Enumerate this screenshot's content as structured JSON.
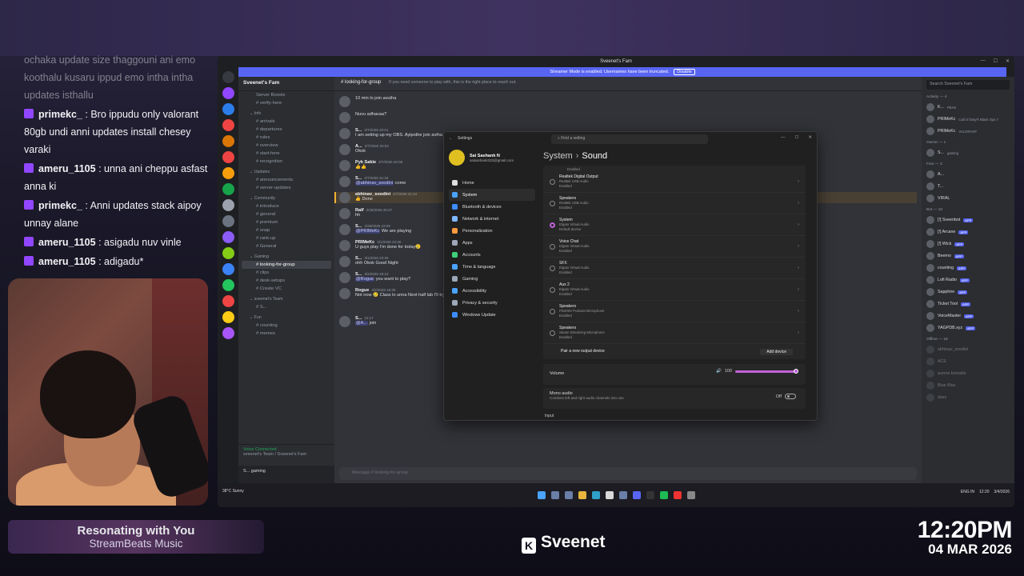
{
  "stream_chat": [
    {
      "badge": false,
      "user": "",
      "text": "ochaka update size thaggouni ani emo koothalu kusaru ippud emo intha intha updates isthallu",
      "faded": true
    },
    {
      "badge": true,
      "user": "primekc_",
      "text": ": Bro ippudu only valorant 80gb undi anni updates install chesey varaki"
    },
    {
      "badge": true,
      "user": "ameru_1105",
      "text": ": unna ani cheppu asfast anna ki"
    },
    {
      "badge": true,
      "user": "primekc_",
      "text": ": Anni updates stack aipoy unnay alane"
    },
    {
      "badge": true,
      "user": "ameru_1105",
      "text": ": asigadu nuv vinle"
    },
    {
      "badge": true,
      "user": "ameru_1105",
      "text": ": adigadu*"
    }
  ],
  "music": {
    "title": "Resonating with You",
    "artist": "StreamBeats Music"
  },
  "brand": {
    "logo": "K",
    "name": "Sveenet"
  },
  "clock": {
    "time": "12:20PM",
    "date": "04 MAR 2026"
  },
  "discord": {
    "window_title": "Sveenet's Fam",
    "banner_text": "Streamer Mode is enabled. Usernames have been truncated.",
    "banner_button": "Disable",
    "server_name": "Sveenet's Fam",
    "server_boosts": "Server Boosts",
    "channels": [
      {
        "type": "ch",
        "name": "verify-here"
      },
      {
        "type": "cat",
        "name": "Info"
      },
      {
        "type": "ch",
        "name": "arrivals"
      },
      {
        "type": "ch",
        "name": "departures"
      },
      {
        "type": "ch",
        "name": "rules"
      },
      {
        "type": "ch",
        "name": "overview"
      },
      {
        "type": "ch",
        "name": "start-here"
      },
      {
        "type": "ch",
        "name": "recognition"
      },
      {
        "type": "cat",
        "name": "Updates"
      },
      {
        "type": "ch",
        "name": "announcements"
      },
      {
        "type": "ch",
        "name": "server-updates"
      },
      {
        "type": "cat",
        "name": "Community"
      },
      {
        "type": "ch",
        "name": "introduce"
      },
      {
        "type": "ch",
        "name": "general"
      },
      {
        "type": "ch",
        "name": "premium"
      },
      {
        "type": "ch",
        "name": "snap"
      },
      {
        "type": "ch",
        "name": "rank-up"
      },
      {
        "type": "ch",
        "name": "General"
      },
      {
        "type": "cat",
        "name": "Gaming"
      },
      {
        "type": "sel",
        "name": "looking-for-group"
      },
      {
        "type": "ch",
        "name": "clips"
      },
      {
        "type": "ch",
        "name": "desk-setups"
      },
      {
        "type": "ch",
        "name": "Create VC"
      },
      {
        "type": "cat",
        "name": "sveenet's Team"
      },
      {
        "type": "ch",
        "name": "S..."
      },
      {
        "type": "cat",
        "name": "Fun"
      },
      {
        "type": "ch",
        "name": "counting"
      },
      {
        "type": "ch",
        "name": "memes"
      }
    ],
    "voice_connected": "Voice Connected",
    "voice_sub": "sveenet's Team / Sveenet's Fam",
    "user_status": "S... gaming",
    "channel_header": "looking-for-group",
    "channel_topic": "If you need someone to play with, this is the right place to reach out.",
    "messages": [
      {
        "name": "",
        "ts": "",
        "text": "10 min lo join avutha",
        "hl": false
      },
      {
        "name": "",
        "ts": "",
        "text": "Nuvu adhavaa?",
        "hl": false
      },
      {
        "name": "S...",
        "ts": "2/7/2026 20:01",
        "text": "I am setting up my OBS. Ayipothe join avtha",
        "hl": false
      },
      {
        "name": "A...",
        "ts": "2/7/2026 20:03",
        "text": "Okok",
        "hl": false
      },
      {
        "name": "Pyk Sakie",
        "ts": "2/7/2026 20:08",
        "text": "👍👍",
        "hl": false
      },
      {
        "name": "S...",
        "ts": "2/7/2026 21:34",
        "text": "@abhinav_soodini come",
        "hl": false
      },
      {
        "name": "abhinav_soodini",
        "ts": "2/7/2026 21:34",
        "text": "👍 Done",
        "hl": true
      },
      {
        "name": "Ralf",
        "ts": "2/25/2026 20:27",
        "text": "hh",
        "hl": false
      },
      {
        "name": "S...",
        "ts": "2/26/2026 23:29",
        "text": "@PRIMeKc We are playing",
        "hl": false
      },
      {
        "name": "PRIMeKc",
        "ts": "3/1/2026 23:30",
        "text": "U guys play I'm done for today🥲",
        "hl": false
      },
      {
        "name": "S...",
        "ts": "3/1/2026 23:30",
        "text": "ohh Okok  Good Night",
        "hl": false
      },
      {
        "name": "S...",
        "ts": "3/2/2026 18:13",
        "text": "@Rogue you want to play?",
        "hl": false
      },
      {
        "name": "Rogue",
        "ts": "3/2/2026 18:30",
        "text": "Not now 🥲  Class lo unna  Next half lab I'll try then  Eppudu ochav",
        "hl": false
      },
      {
        "name": "S...",
        "ts": "12:17",
        "text": "@A... join",
        "hl": false
      }
    ],
    "day_separator": "March 4, 2026",
    "input_placeholder": "Message # looking-for-group",
    "members_search": "Search Sveenet's Fam",
    "members": [
      {
        "group": "Activity — 4",
        "items": [
          {
            "name": "K...",
            "sub": "PEAK",
            "app": false
          },
          {
            "name": "PRIMeKc",
            "sub": "Call of Duty® Black Ops 7",
            "app": false
          },
          {
            "name": "PRIMeKc",
            "sub": "VALORANT",
            "app": false
          }
        ]
      },
      {
        "group": "Owner — 1",
        "items": [
          {
            "name": "S...",
            "sub": "gaming",
            "app": false
          }
        ]
      },
      {
        "group": "Fam — 3",
        "items": [
          {
            "name": "A...",
            "sub": "",
            "app": false
          },
          {
            "name": "T...",
            "sub": "",
            "app": false
          },
          {
            "name": "VIRAL",
            "sub": "",
            "app": false
          }
        ]
      },
      {
        "group": "Bot — 10",
        "items": [
          {
            "name": "[!] Sveenbot",
            "sub": "",
            "app": true
          },
          {
            "name": "[!] Arcane",
            "sub": "",
            "app": true
          },
          {
            "name": "[!] Wick",
            "sub": "",
            "app": true
          },
          {
            "name": "Beemo",
            "sub": "",
            "app": true
          },
          {
            "name": "counting",
            "sub": "",
            "app": true
          },
          {
            "name": "Lofi Radio",
            "sub": "",
            "app": true
          },
          {
            "name": "Sapphire",
            "sub": "",
            "app": true
          },
          {
            "name": "Ticket Tool",
            "sub": "",
            "app": true
          },
          {
            "name": "VoiceMaster",
            "sub": "",
            "app": true
          },
          {
            "name": "YAGPDB.xyz",
            "sub": "",
            "app": true
          }
        ]
      },
      {
        "group": "Offline — 18",
        "items": [
          {
            "name": "abhinav_soodini",
            "sub": "",
            "app": false
          },
          {
            "name": "ACE",
            "sub": "",
            "app": false
          },
          {
            "name": "aurora borealis",
            "sub": "",
            "app": false
          },
          {
            "name": "Blue Blaz",
            "sub": "",
            "app": false
          },
          {
            "name": "daxx",
            "sub": "",
            "app": false
          }
        ]
      }
    ]
  },
  "settings": {
    "title": "Settings",
    "search_placeholder": "Find a setting",
    "profile_name": "Sai Sashank N",
    "profile_email": "saisashank333@gmail.com",
    "nav": [
      {
        "label": "Home",
        "color": "#e0e0e0"
      },
      {
        "label": "System",
        "color": "#4aa3ff",
        "selected": true
      },
      {
        "label": "Bluetooth & devices",
        "color": "#3d8cff"
      },
      {
        "label": "Network & internet",
        "color": "#7fb8ff"
      },
      {
        "label": "Personalization",
        "color": "#ff9a3d"
      },
      {
        "label": "Apps",
        "color": "#9ea7b8"
      },
      {
        "label": "Accounts",
        "color": "#3dcf7a"
      },
      {
        "label": "Time & language",
        "color": "#4aa3ff"
      },
      {
        "label": "Gaming",
        "color": "#9ea7b8"
      },
      {
        "label": "Accessibility",
        "color": "#4aa3ff"
      },
      {
        "label": "Privacy & security",
        "color": "#9ea7b8"
      },
      {
        "label": "Windows Update",
        "color": "#3d8cff"
      }
    ],
    "crumb_parent": "System",
    "crumb_page": "Sound",
    "devices_header": "Enabled",
    "devices": [
      {
        "name": "Realtek Digital Output",
        "sub1": "Realtek USB Audio",
        "sub2": "Enabled",
        "selected": false
      },
      {
        "name": "Speakers",
        "sub1": "Realtek USB Audio",
        "sub2": "Enabled",
        "selected": false
      },
      {
        "name": "System",
        "sub1": "Elgato Virtual Audio",
        "sub2": "Default device",
        "selected": true
      },
      {
        "name": "Voice Chat",
        "sub1": "Elgato Virtual Audio",
        "sub2": "Enabled",
        "selected": false
      },
      {
        "name": "SFX",
        "sub1": "Elgato Virtual Audio",
        "sub2": "Enabled",
        "selected": false
      },
      {
        "name": "Aux 2",
        "sub1": "Elgato Virtual Audio",
        "sub2": "Enabled",
        "selected": false
      },
      {
        "name": "Speakers",
        "sub1": "PD200X Podcast Microphone",
        "sub2": "Enabled",
        "selected": false
      },
      {
        "name": "Speakers",
        "sub1": "Steam Streaming Microphone",
        "sub2": "Enabled",
        "selected": false
      }
    ],
    "pair_label": "Pair a new output device",
    "add_device": "Add device",
    "volume_label": "Volume",
    "volume_value": "100",
    "volume_fraction": 1.0,
    "mono_label": "Mono audio",
    "mono_desc": "Combine left and right audio channels into one",
    "mono_state": "Off",
    "input_label": "Input"
  },
  "taskbar": {
    "weather_temp": "38°C",
    "weather_desc": "Sunny",
    "lang": "ENG IN",
    "time": "12:20",
    "date": "3/4/2026"
  }
}
